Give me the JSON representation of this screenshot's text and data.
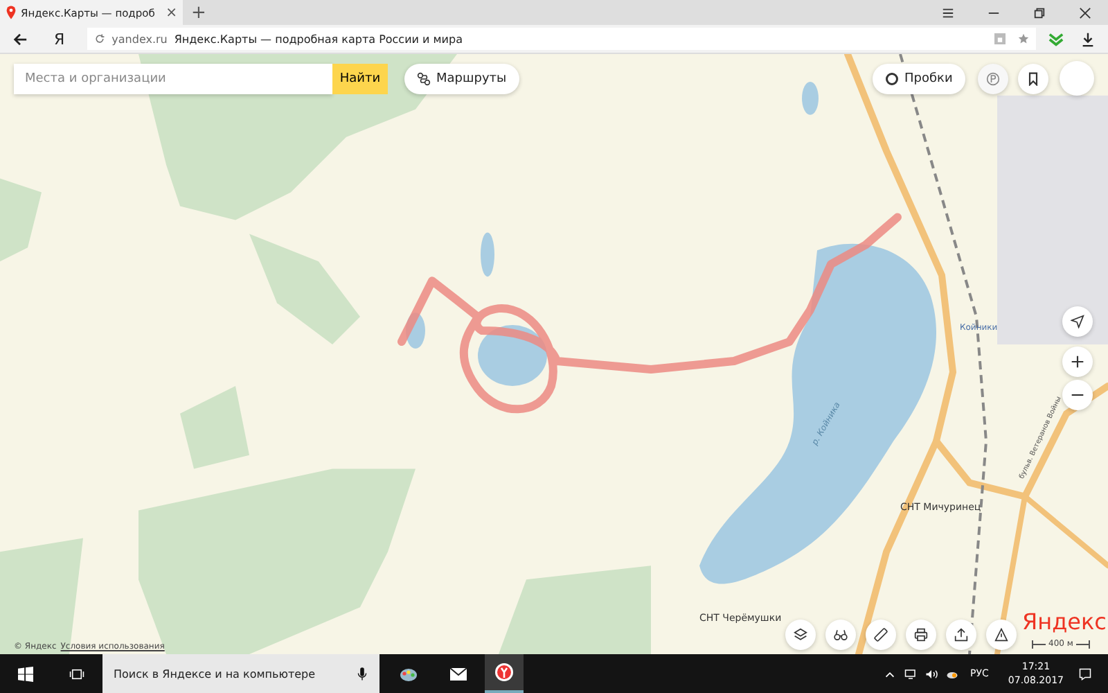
{
  "browser": {
    "tab_title": "Яндекс.Карты — подроб",
    "tab_close": "×",
    "new_tab": "+",
    "domain": "yandex.ru",
    "page_title": "Яндекс.Карты — подробная карта России и мира",
    "logo": "Я"
  },
  "map": {
    "search": {
      "placeholder": "Места и организации",
      "button": "Найти"
    },
    "routes_button": "Маршруты",
    "traffic_button": "Пробки",
    "labels": [
      {
        "text": "Койники",
        "kind": "station"
      },
      {
        "text": "р. Койника",
        "kind": "river"
      },
      {
        "text": "СНТ Мичуринец",
        "kind": "place"
      },
      {
        "text": "СНТ Черёмушки",
        "kind": "place"
      },
      {
        "text": "бульв. Ветеранов Войны",
        "kind": "street"
      }
    ],
    "logo": "Яндекс",
    "scale": "400 м",
    "copyright": "© Яндекс",
    "terms_link": "Условия использования"
  },
  "taskbar": {
    "search": {
      "placeholder": "Поиск в Яндексе и на компьютере"
    },
    "language": "РУС",
    "time": "17:21",
    "date": "07.08.2017"
  }
}
